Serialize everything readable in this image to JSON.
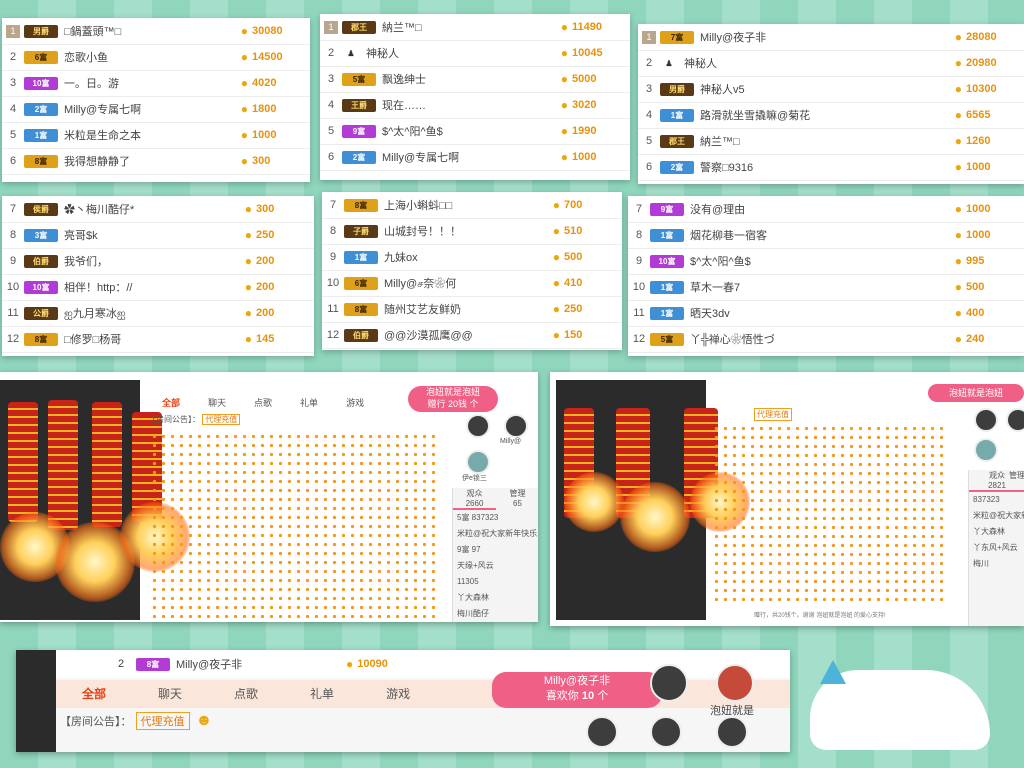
{
  "panels": [
    {
      "rows": [
        {
          "rank": "1",
          "badge": "男爵",
          "name": "□鍋蓋頭™□",
          "amount": "30080"
        },
        {
          "rank": "2",
          "badge": "6富",
          "name": "恋歌小鱼",
          "amount": "14500"
        },
        {
          "rank": "3",
          "badge": "10富",
          "name": "一。日。游",
          "amount": "4020"
        },
        {
          "rank": "4",
          "badge": "2富",
          "name": "Milly@专属七啊",
          "amount": "1800"
        },
        {
          "rank": "5",
          "badge": "1富",
          "name": "米粒是生命之本",
          "amount": "1000"
        },
        {
          "rank": "6",
          "badge": "8富",
          "name": "我得想静静了",
          "amount": "300"
        }
      ]
    },
    {
      "rows": [
        {
          "rank": "1",
          "badge": "郡王",
          "name": "納兰™□",
          "amount": "11490"
        },
        {
          "rank": "2",
          "badge": "",
          "name": "神秘人",
          "amount": "10045"
        },
        {
          "rank": "3",
          "badge": "5富",
          "name": "飘逸绅士",
          "amount": "5000"
        },
        {
          "rank": "4",
          "badge": "王爵",
          "name": "现在……",
          "amount": "3020"
        },
        {
          "rank": "5",
          "badge": "9富",
          "name": "$^太^阳^鱼$",
          "amount": "1990"
        },
        {
          "rank": "6",
          "badge": "2富",
          "name": "Milly@专属七啊",
          "amount": "1000"
        }
      ]
    },
    {
      "rows": [
        {
          "rank": "1",
          "badge": "7富",
          "name": "Milly@夜子非",
          "amount": "28080"
        },
        {
          "rank": "2",
          "badge": "",
          "name": "神秘人",
          "amount": "20980"
        },
        {
          "rank": "3",
          "badge": "男爵",
          "name": "神秘人v5",
          "amount": "10300"
        },
        {
          "rank": "4",
          "badge": "1富",
          "name": "路滑就坐雪撬嘛@菊花",
          "amount": "6565"
        },
        {
          "rank": "5",
          "badge": "郡王",
          "name": "納兰™□",
          "amount": "1260"
        },
        {
          "rank": "6",
          "badge": "2富",
          "name": "警察□9316",
          "amount": "1000"
        }
      ]
    },
    {
      "rows": [
        {
          "rank": "7",
          "badge": "侯爵",
          "name": "✿丶梅川酷仔*",
          "amount": "300"
        },
        {
          "rank": "8",
          "badge": "3富",
          "name": "亮哥$k",
          "amount": "250"
        },
        {
          "rank": "9",
          "badge": "伯爵",
          "name": "我爷们，",
          "amount": "200"
        },
        {
          "rank": "10",
          "badge": "10富",
          "name": "相伴！http：//",
          "amount": "200"
        },
        {
          "rank": "11",
          "badge": "公爵",
          "name": "ஐ九月寒冰ஐ",
          "amount": "200"
        },
        {
          "rank": "12",
          "badge": "8富",
          "name": "□修罗□杨哥",
          "amount": "145"
        }
      ]
    },
    {
      "rows": [
        {
          "rank": "7",
          "badge": "8富",
          "name": "上海小蝌蚪□□",
          "amount": "700"
        },
        {
          "rank": "8",
          "badge": "子爵",
          "name": "山城封号！！！",
          "amount": "510"
        },
        {
          "rank": "9",
          "badge": "1富",
          "name": "九妹ox",
          "amount": "500"
        },
        {
          "rank": "10",
          "badge": "6富",
          "name": "Milly@ச奈❀何",
          "amount": "410"
        },
        {
          "rank": "11",
          "badge": "8富",
          "name": "随州艾艺友鲜奶",
          "amount": "250"
        },
        {
          "rank": "12",
          "badge": "伯爵",
          "name": "@@沙漠孤鹰@@",
          "amount": "150"
        }
      ]
    },
    {
      "rows": [
        {
          "rank": "7",
          "badge": "9富",
          "name": "没有@理由",
          "amount": "1000"
        },
        {
          "rank": "8",
          "badge": "1富",
          "name": "烟花柳巷一宿客",
          "amount": "1000"
        },
        {
          "rank": "9",
          "badge": "10富",
          "name": "$^太^阳^鱼$",
          "amount": "995"
        },
        {
          "rank": "10",
          "badge": "1富",
          "name": "草木一春7",
          "amount": "500"
        },
        {
          "rank": "11",
          "badge": "1富",
          "name": "晒天3dv",
          "amount": "400"
        },
        {
          "rank": "12",
          "badge": "5富",
          "name": "丫╬禅心❀悟性づ",
          "amount": "240"
        }
      ]
    }
  ],
  "shot1": {
    "tabs": [
      "全部",
      "聊天",
      "点歌",
      "礼单",
      "游戏"
    ],
    "notice": "【房间公告】：",
    "recharge": "代理充值",
    "pill": "泡妞就是泡妞",
    "pill2": "赠行 20钱 个",
    "audience": "观众",
    "audience_count": "2660",
    "manage": "管理",
    "manage_count": "65",
    "chat": [
      "5富 837323",
      "米粒@祝大家新年快乐",
      "9富 97",
      "天缘+风云",
      "11305",
      "丫大森林",
      "梅川酷仔"
    ],
    "avatars": [
      "Milly@",
      "伊e锁三"
    ]
  },
  "shot2": {
    "pill": "泡妞就是泡妞",
    "notice_recharge": "代理充值",
    "audience": "观众",
    "audience_count": "2821",
    "manage": "管理",
    "chat": [
      "837323",
      "米粒@祝大家新年快",
      "丫大森林",
      "丫东风+风云",
      "梅川"
    ],
    "footer": "赠行，共20钱个。谢谢 泡妞就是泡妞 的爱心支持!"
  },
  "bottom": {
    "rank": "2",
    "badge": "8富",
    "name": "Milly@夜子非",
    "amount": "10090",
    "tabs": [
      "全部",
      "聊天",
      "点歌",
      "礼单",
      "游戏"
    ],
    "notice": "【房间公告】：",
    "recharge": "代理充值",
    "pill_name": "Milly@夜子非",
    "pill_text": "喜欢你",
    "pill_count": "10",
    "pill_unit": "个",
    "avatar_label": "泡妞就是"
  }
}
